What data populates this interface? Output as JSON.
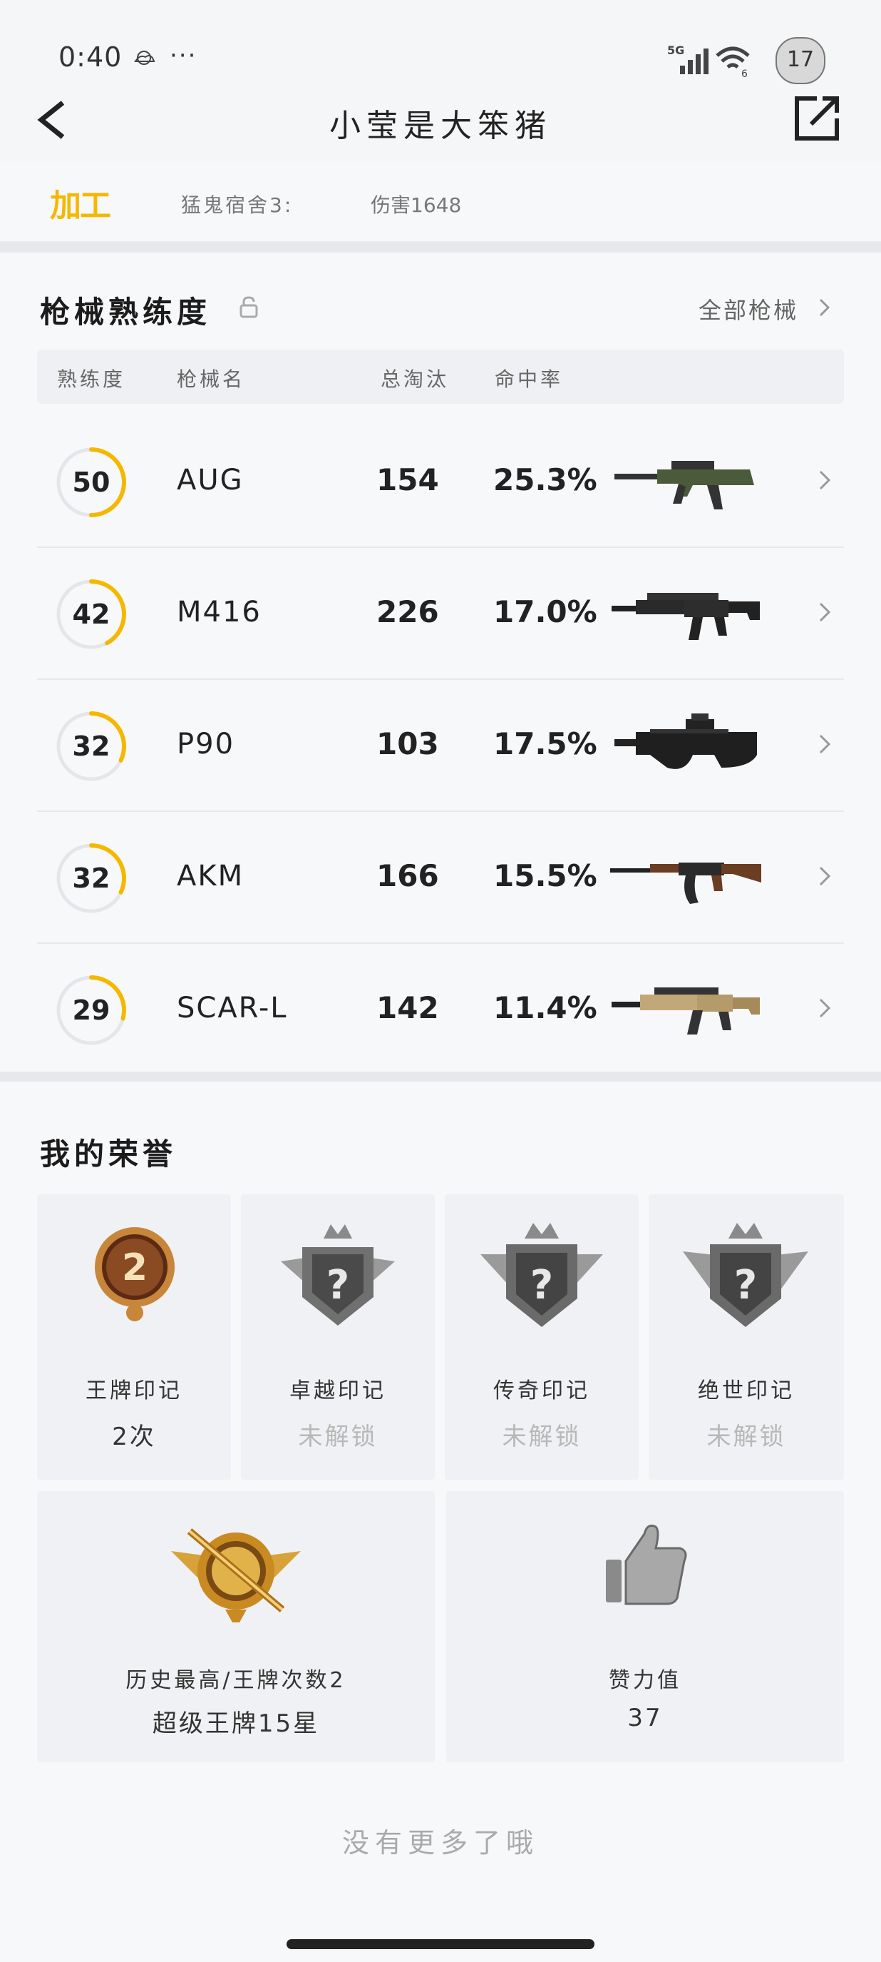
{
  "status_bar": {
    "time": "0:40",
    "dots": "···",
    "network": "5G",
    "wifi_sub": "6",
    "avatar_badge": "17"
  },
  "header": {
    "title": "小莹是大笨猪"
  },
  "top_row": {
    "logo": "加工",
    "map": "猛鬼宿舍3:",
    "damage": "伤害1648"
  },
  "weapons": {
    "title": "枪械熟练度",
    "all_link": "全部枪械",
    "columns": [
      "熟练度",
      "枪械名",
      "总淘汰",
      "命中率"
    ],
    "rows": [
      {
        "level": "50",
        "name": "AUG",
        "kills": "154",
        "rate": "25.3%",
        "progress": 0.5,
        "icon": "aug-rifle-icon"
      },
      {
        "level": "42",
        "name": "M416",
        "kills": "226",
        "rate": "17.0%",
        "progress": 0.42,
        "icon": "m416-rifle-icon"
      },
      {
        "level": "32",
        "name": "P90",
        "kills": "103",
        "rate": "17.5%",
        "progress": 0.32,
        "icon": "p90-smg-icon"
      },
      {
        "level": "32",
        "name": "AKM",
        "kills": "166",
        "rate": "15.5%",
        "progress": 0.32,
        "icon": "akm-rifle-icon"
      },
      {
        "level": "29",
        "name": "SCAR-L",
        "kills": "142",
        "rate": "11.4%",
        "progress": 0.29,
        "icon": "scar-l-rifle-icon"
      }
    ]
  },
  "honors": {
    "title": "我的荣誉",
    "badges": [
      {
        "name": "王牌印记",
        "value": "2次",
        "badge_number": "2",
        "locked": false
      },
      {
        "name": "卓越印记",
        "value": "未解锁",
        "badge_number": "?",
        "locked": true
      },
      {
        "name": "传奇印记",
        "value": "未解锁",
        "badge_number": "?",
        "locked": true
      },
      {
        "name": "绝世印记",
        "value": "未解锁",
        "badge_number": "?",
        "locked": true
      }
    ],
    "best": {
      "label": "历史最高/王牌次数2",
      "value": "超级王牌15星"
    },
    "likes": {
      "label": "赞力值",
      "value": "37"
    }
  },
  "footer": {
    "no_more": "没有更多了哦"
  },
  "colors": {
    "accent": "#f5b800",
    "ring_track": "#e4e6ea",
    "divider": "#e6e8ec"
  }
}
